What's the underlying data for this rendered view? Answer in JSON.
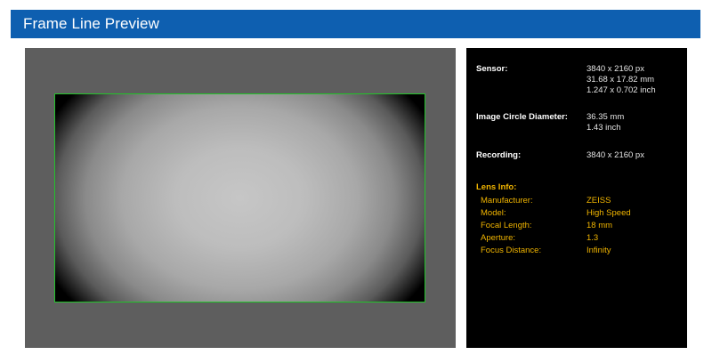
{
  "header": {
    "title": "Frame Line Preview"
  },
  "colors": {
    "header_bg": "#0e5fb0",
    "frame_line": "#22c32a",
    "lens_text": "#f0b400"
  },
  "info": {
    "sensor": {
      "label": "Sensor:",
      "values": [
        "3840 x 2160 px",
        "31.68 x 17.82 mm",
        "1.247 x 0.702 inch"
      ]
    },
    "image_circle": {
      "label": "Image Circle Diameter:",
      "values": [
        "36.35 mm",
        "1.43 inch"
      ]
    },
    "recording": {
      "label": "Recording:",
      "values": [
        "3840 x 2160 px"
      ]
    },
    "lens": {
      "heading": "Lens Info:",
      "items": [
        {
          "key": "Manufacturer:",
          "value": "ZEISS"
        },
        {
          "key": "Model:",
          "value": "High Speed"
        },
        {
          "key": "Focal Length:",
          "value": "18 mm"
        },
        {
          "key": "Aperture:",
          "value": "1.3"
        },
        {
          "key": "Focus Distance:",
          "value": "Infinity"
        }
      ]
    }
  }
}
